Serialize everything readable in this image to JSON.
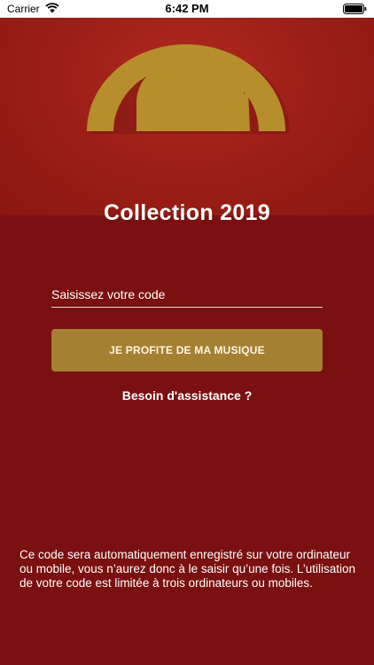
{
  "status_bar": {
    "carrier": "Carrier",
    "time": "6:42 PM"
  },
  "main": {
    "title": "Collection 2019",
    "code_input": {
      "placeholder": "Saisissez votre code",
      "value": ""
    },
    "cta_label": "JE PROFITE DE MA MUSIQUE",
    "help_link": "Besoin d'assistance ?",
    "footer_note": "Ce code sera automatiquement enregistré sur votre ordinateur ou mobile, vous n’aurez donc à le saisir qu’une fois. L’utilisation de votre code est limitée à trois ordinateurs ou mobiles."
  },
  "colors": {
    "background": "#7a1010",
    "hero_red": "#9d1f17",
    "gold": "#a48033",
    "logo_gold": "#b78e2c"
  },
  "icons": [
    "wifi-icon",
    "battery-icon",
    "gramophone-logo-icon"
  ]
}
